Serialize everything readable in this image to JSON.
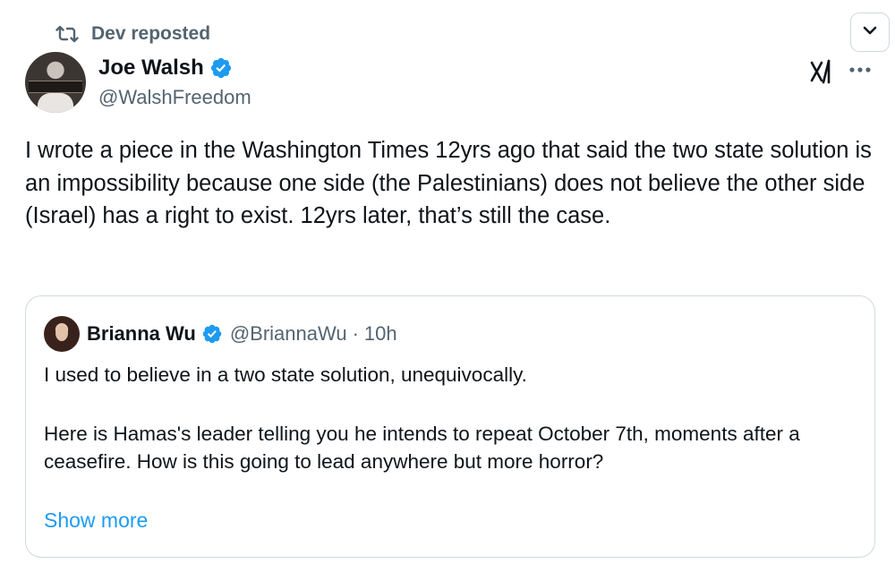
{
  "repost": {
    "label": "Dev reposted",
    "icon": "repost-icon"
  },
  "post": {
    "author_name": "Joe Walsh",
    "author_handle": "@WalshFreedom",
    "verified": true,
    "text": "I wrote a piece in the Washington Times 12yrs ago that said the two state solution is an impossibility because one side (the Palestinians) does not believe the other side (Israel) has a right to exist. 12yrs later, that’s still the case."
  },
  "quote": {
    "author_name": "Brianna Wu",
    "author_handle": "@BriannaWu",
    "separator": "·",
    "time": "10h",
    "verified": true,
    "line1": "I used to believe in a two state solution, unequivocally.",
    "para2": "Here is Hamas's leader telling you he intends to repeat October 7th, moments after a ceasefire. How is this going to lead anywhere but more horror?",
    "show_more": "Show more"
  },
  "colors": {
    "text": "#0f1419",
    "secondary": "#536471",
    "accent": "#1d9bf0",
    "border": "#cfd9de"
  },
  "icons": [
    "chevron-down-icon",
    "grok-icon",
    "more-icon",
    "verified-badge-icon"
  ]
}
